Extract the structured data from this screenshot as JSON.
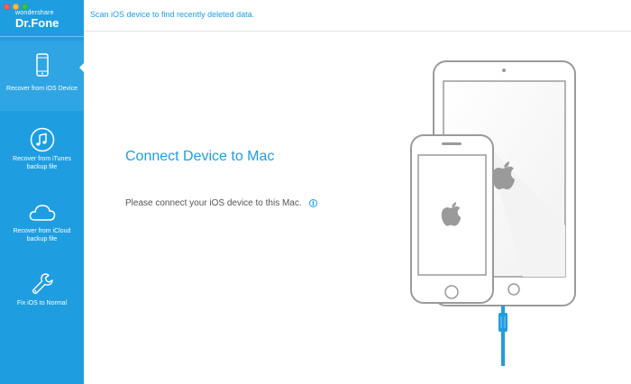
{
  "window": {
    "traffic_lights": [
      "close",
      "minimize",
      "zoom"
    ]
  },
  "brand": {
    "logo_top": "wondershare",
    "logo_main": "Dr.Fone"
  },
  "sidebar": {
    "items": [
      {
        "label": "Recover from iOS Device",
        "icon": "phone-icon",
        "active": true
      },
      {
        "label": "Recover from iTunes backup file",
        "icon": "music-note-icon",
        "active": false
      },
      {
        "label": "Recover from iCloud backup file",
        "icon": "cloud-icon",
        "active": false
      },
      {
        "label": "Fix iOS to Normal",
        "icon": "wrench-icon",
        "active": false
      }
    ]
  },
  "header": {
    "message": "Scan iOS device to find recently deleted data."
  },
  "main": {
    "title": "Connect Device to Mac",
    "description": "Please connect your iOS device to this Mac.",
    "info_icon": "info-icon"
  },
  "colors": {
    "accent": "#1e9ee1",
    "sidebar_bg": "#1e9ee1",
    "text_gray": "#555555",
    "device_gray": "#9a9a9a"
  }
}
